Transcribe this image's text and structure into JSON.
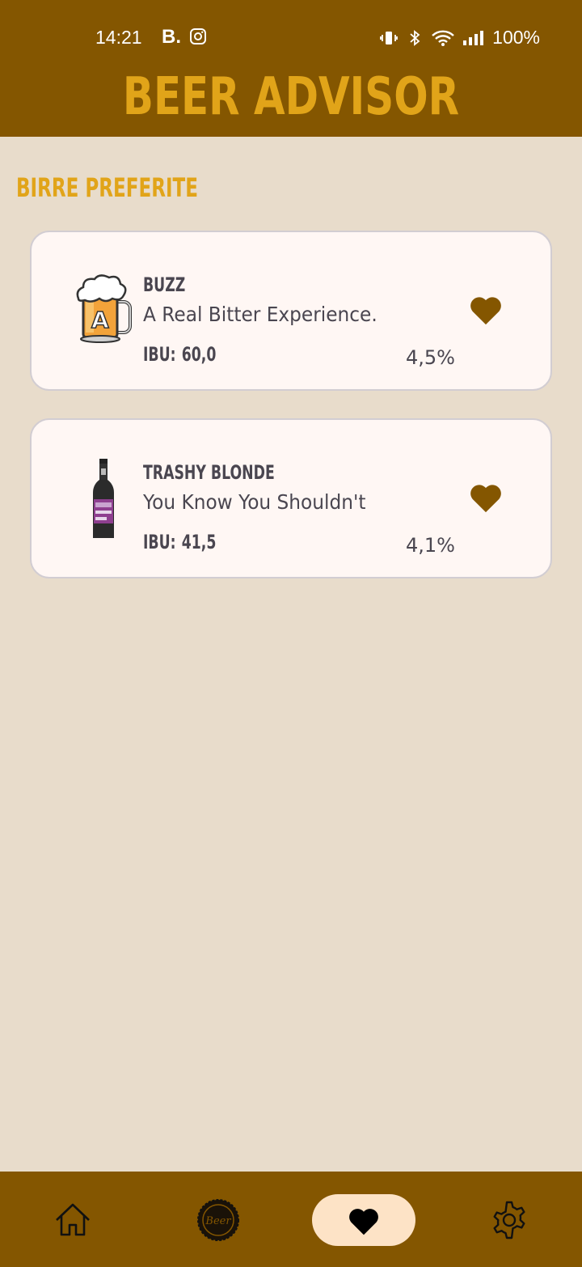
{
  "status_bar": {
    "time": "14:21",
    "app_badge": "B.",
    "battery": "100%"
  },
  "header": {
    "title": "BEER ADVISOR"
  },
  "section": {
    "title": "BIRRE PREFERITE"
  },
  "beers": [
    {
      "name": "BUZZ",
      "tagline": "A Real Bitter Experience.",
      "ibu_label": "IBU:",
      "ibu_value": "60,0",
      "abv": "4,5%",
      "image_icon": "beer-mug-icon",
      "favorite_icon": "heart-icon"
    },
    {
      "name": "TRASHY BLONDE",
      "tagline": "You Know You Shouldn't",
      "ibu_label": "IBU:",
      "ibu_value": "41,5",
      "abv": "4,1%",
      "image_icon": "beer-bottle-icon",
      "favorite_icon": "heart-icon"
    }
  ],
  "bottom_nav": {
    "items": [
      {
        "icon": "home-icon",
        "active": false
      },
      {
        "icon": "beer-cap-icon",
        "active": false
      },
      {
        "icon": "heart-icon",
        "active": true
      },
      {
        "icon": "settings-gear-icon",
        "active": false
      }
    ]
  },
  "colors": {
    "header_bg": "#845600",
    "accent": "#e1a419",
    "background": "#e8dccb",
    "card_bg": "#fff7f4",
    "text": "#4a4650",
    "nav_active_bg": "#fde3c6"
  }
}
